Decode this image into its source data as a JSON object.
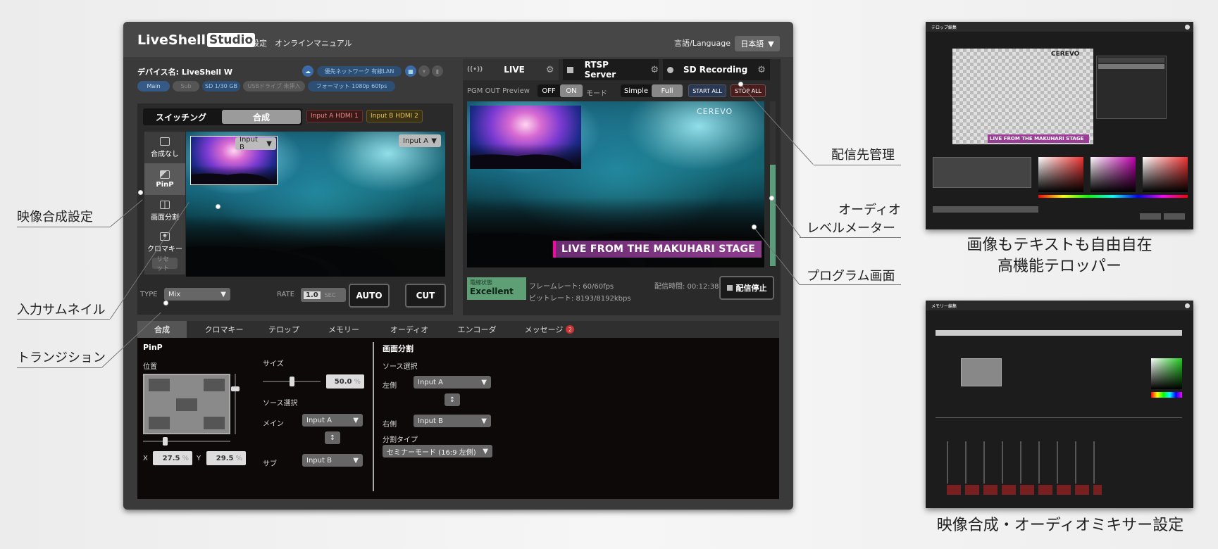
{
  "app": {
    "logo_text": "LiveShell",
    "logo_box": "Studio",
    "settings": "設定",
    "manual": "オンラインマニュアル",
    "lang_label": "言語/Language",
    "lang_value": "日本語"
  },
  "device": {
    "name": "デバイス名: LiveShell W",
    "network": "優先ネットワーク 有線LAN",
    "main": "Main",
    "sub": "Sub",
    "sd": "SD 1/30 GB",
    "usb": "USBドライブ 未挿入",
    "format": "フォーマット 1080p 60fps"
  },
  "switch": {
    "tab_switch": "スイッチング",
    "tab_compose": "合成",
    "input_a_badge": "Input A HDMI 1",
    "input_b_badge": "Input B HDMI 2",
    "modes": [
      "合成なし",
      "PinP",
      "画面分割",
      "クロマキー"
    ],
    "reset": "リセット",
    "pip_select": "Input B",
    "main_select": "Input A",
    "type_label": "TYPE",
    "type_value": "Mix",
    "rate_label": "RATE",
    "rate_value": "1.0",
    "rate_unit": "SEC",
    "auto": "AUTO",
    "cut": "CUT"
  },
  "live": {
    "tab_live": "LIVE",
    "tab_rtsp": "RTSP Server",
    "tab_sd": "SD Recording",
    "pgm_label": "PGM OUT Preview",
    "off": "OFF",
    "on": "ON",
    "mode_label": "モード",
    "simple": "Simple",
    "full": "Full",
    "start_all": "START ALL",
    "stop_all": "STOP ALL",
    "brand": "CEREVO",
    "telop": "LIVE FROM THE MAKUHARI STAGE",
    "status_label": "電線状態",
    "status_value": "Excellent",
    "framerate": "フレームレート: 60/60fps",
    "bitrate": "ビットレート: 8193/8192kbps",
    "time": "配信時間: 00:12:38",
    "stop": "配信停止"
  },
  "bottom": {
    "tabs": [
      "合成",
      "クロマキー",
      "テロップ",
      "メモリー",
      "オーディオ",
      "エンコーダ",
      "メッセージ"
    ],
    "msg_count": "2",
    "pinp_title": "PinP",
    "position": "位置",
    "size": "サイズ",
    "size_value": "50.0",
    "pct": "%",
    "source": "ソース選択",
    "main": "メイン",
    "main_value": "Input A",
    "sub": "サブ",
    "sub_value": "Input B",
    "x": "X",
    "x_value": "27.5",
    "y": "Y",
    "y_value": "29.5",
    "split_title": "画面分割",
    "split_source": "ソース選択",
    "left": "左側",
    "left_value": "Input A",
    "right": "右側",
    "right_value": "Input B",
    "split_type": "分割タイプ",
    "split_type_value": "セミナーモード (16:9 左側)"
  },
  "callouts": {
    "compose": "映像合成設定",
    "thumb": "入力サムネイル",
    "transition": "トランジション",
    "dest": "配信先管理",
    "audio1": "オーディオ",
    "audio2": "レベルメーター",
    "program": "プログラム画面"
  },
  "captions": {
    "telop1": "画像もテキストも自由自在",
    "telop2": "高機能テロッパー",
    "memory": "映像合成・オーディオミキサー設定"
  },
  "thumbs": {
    "telop_title": "テロップ編集",
    "memory_title": "メモリー編集",
    "telop_text": "LIVE FROM THE MAKUHARI STAGE",
    "brand": "CEREVO"
  }
}
